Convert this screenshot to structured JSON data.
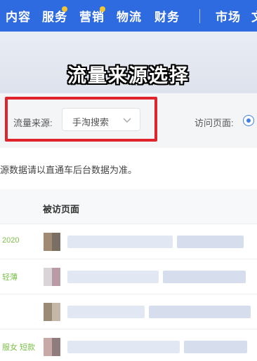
{
  "nav": {
    "items": [
      "内容",
      "服务",
      "营销",
      "物流",
      "财务",
      "市场"
    ],
    "partial": "文",
    "dots_on": [
      "服务",
      "营销"
    ]
  },
  "banner": {
    "title": "流量来源选择"
  },
  "filter": {
    "source_label": "流量来源:",
    "source_value": "手淘搜索",
    "page_label": "访问页面:"
  },
  "notice": "源数据请以直通车后台数据为准。",
  "table": {
    "header": "被访页面",
    "rows": [
      "2020",
      "轻薄",
      "",
      "服女 短款"
    ]
  },
  "colors": {
    "nav": "#2f6be0",
    "highlight_box": "#e0242b",
    "accent_green": "#7cbf4a"
  },
  "icons": [
    "chevron-down-icon",
    "radio-icon"
  ]
}
